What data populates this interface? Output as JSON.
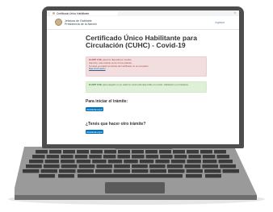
{
  "browser": {
    "tab_title": "Certificado Único Habilitante",
    "close_glyph": "×"
  },
  "site": {
    "org_line1": "Jefatura de Gabinete",
    "org_line2": "Presidencia de la Nación",
    "nav_link": "Ingresar",
    "logo_icon": "national-seal-icon"
  },
  "page": {
    "title": "Certificado Único Habilitante para Circulación (CUHC) - Covid-19",
    "alert_error": {
      "line1_bold": "El APP CUIL",
      "line1": " para los dispositivos moviles.",
      "line2": "Atención: este trámite es de forma gratuita.",
      "line3": "Si usted ya realizó el trámite del certificado no es necesario.",
      "link": "Más información"
    },
    "alert_success": {
      "bold": "El APP CUIL",
      "text": " para cargarlo en su teléfono móvil está disponible en el sitio. Validación en el teléfono."
    },
    "section1_heading": "Para iniciar el trámite:",
    "section1_button": "INGRESE AQUÍ",
    "section2_heading": "¿Tenés que hacer otro trámite?",
    "section2_button": "INGRESE AQUÍ"
  },
  "colors": {
    "bezel": "#4d4d4d",
    "body": "#8a8a8a",
    "keys": "#3a3a3a",
    "trackpad": "#5a5a5a",
    "button": "#0072bb",
    "alert_error_bg": "#f2dede",
    "alert_success_bg": "#dff0d8"
  }
}
